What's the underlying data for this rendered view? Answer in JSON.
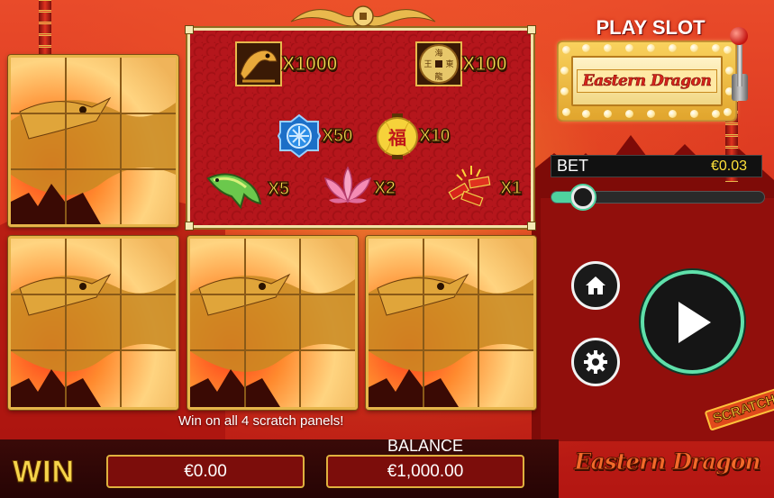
{
  "header": {
    "play_slot_label": "PLAY SLOT"
  },
  "marquee": {
    "logo_text": "Eastern Dragon"
  },
  "paytable": {
    "items": [
      {
        "symbol": "dragon-icon",
        "multiplier": "X1000"
      },
      {
        "symbol": "coin-icon",
        "multiplier": "X100"
      },
      {
        "symbol": "medallion-icon",
        "multiplier": "X50"
      },
      {
        "symbol": "lantern-icon",
        "multiplier": "X10"
      },
      {
        "symbol": "fish-icon",
        "multiplier": "X5"
      },
      {
        "symbol": "lotus-icon",
        "multiplier": "X2"
      },
      {
        "symbol": "firecracker-icon",
        "multiplier": "X1"
      }
    ],
    "coin_chars": [
      "海",
      "王",
      "東",
      "龍"
    ],
    "lantern_char": "福"
  },
  "bet": {
    "label": "BET",
    "value": "€0.03",
    "slider_fraction": 0.15
  },
  "message": "Win on all 4 scratch panels!",
  "win": {
    "title": "WIN",
    "value": "€0.00"
  },
  "balance": {
    "title": "BALANCE",
    "value": "€1,000.00"
  },
  "branding": {
    "scratch_badge": "SCRATCH",
    "bottom_logo": "Eastern Dragon"
  },
  "colors": {
    "accent_gold": "#e6b54a",
    "play_ring": "#5fe0aa",
    "bet_value": "#ffe13a"
  }
}
